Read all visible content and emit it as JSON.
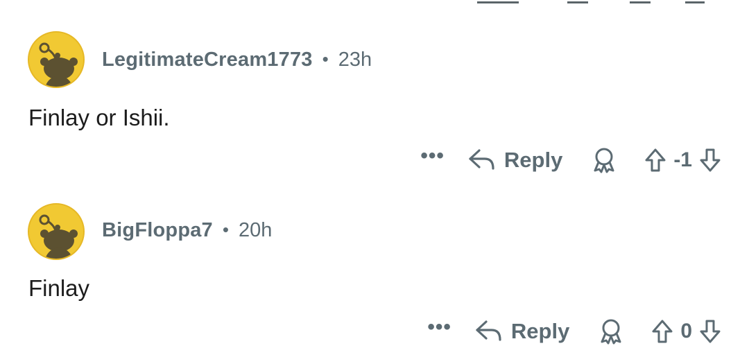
{
  "colors": {
    "meta": "#5c6b73",
    "text": "#1c1c1c",
    "avatar": "#f1c933"
  },
  "comments": [
    {
      "username": "LegitimateCream1773",
      "separator": "•",
      "time": "23h",
      "body": "Finlay or Ishii.",
      "more": "•••",
      "reply_label": "Reply",
      "score": "-1",
      "icons": [
        "reply-arrow-icon",
        "award-icon",
        "upvote-icon",
        "downvote-icon"
      ]
    },
    {
      "username": "BigFloppa7",
      "separator": "•",
      "time": "20h",
      "body": "Finlay",
      "more": "•••",
      "reply_label": "Reply",
      "score": "0",
      "icons": [
        "reply-arrow-icon",
        "award-icon",
        "upvote-icon",
        "downvote-icon"
      ]
    }
  ]
}
